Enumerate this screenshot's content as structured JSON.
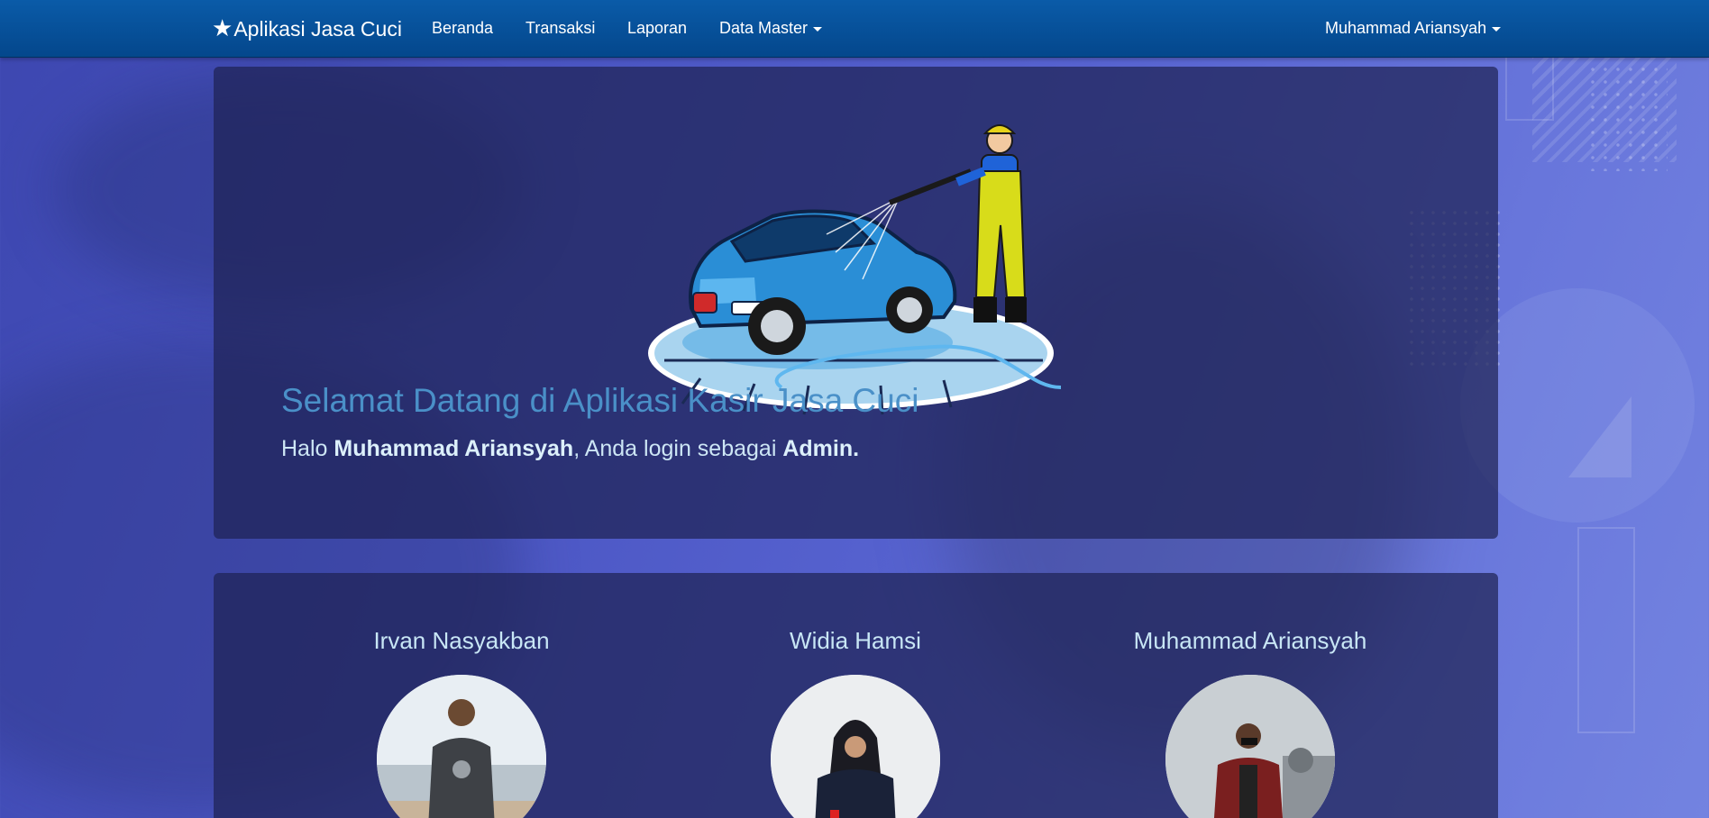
{
  "navbar": {
    "brand_icon": "star-icon",
    "brand": "Aplikasi Jasa Cuci",
    "links": [
      "Beranda",
      "Transaksi",
      "Laporan"
    ],
    "data_master": "Data Master",
    "user": "Muhammad Ariansyah"
  },
  "hero": {
    "title": "Selamat Datang di Aplikasi Kasir Jasa Cuci",
    "greeting_prefix": "Halo ",
    "user_name": "Muhammad Ariansyah",
    "greeting_middle": ", Anda login sebagai ",
    "role": "Admin."
  },
  "team": [
    {
      "name": "Irvan Nasyakban"
    },
    {
      "name": "Widia Hamsi"
    },
    {
      "name": "Muhammad Ariansyah"
    }
  ],
  "colors": {
    "navbar": "#04478c",
    "title": "#4a90c8",
    "text": "#cde6f5"
  }
}
